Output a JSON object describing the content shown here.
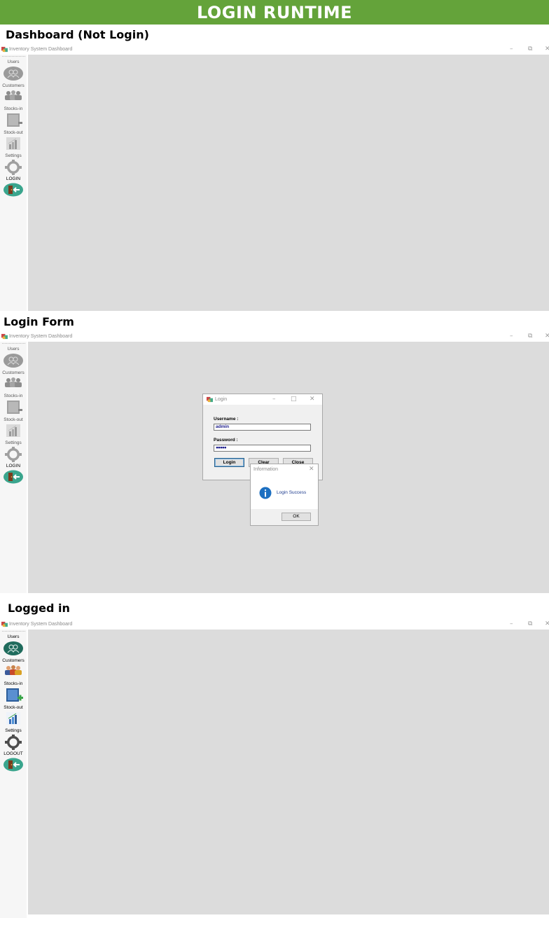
{
  "banner": {
    "title": "LOGIN RUNTIME"
  },
  "sections": [
    {
      "heading": "Dashboard (Not Login)",
      "window_title": "Inventory System Dashboard",
      "nav": [
        {
          "label": "Users",
          "icon": "users-icon",
          "active": false
        },
        {
          "label": "Customers",
          "icon": "customers-icon",
          "active": false
        },
        {
          "label": "Stocks-in",
          "icon": "stocks-in-icon",
          "active": false
        },
        {
          "label": "Stock-out",
          "icon": "stock-out-icon",
          "active": false
        },
        {
          "label": "Settings",
          "icon": "gear-icon",
          "active": false
        },
        {
          "label": "LOGIN",
          "icon": "login-door-icon",
          "active": true
        }
      ]
    },
    {
      "heading": "Login Form",
      "window_title": "Inventory System Dashboard",
      "nav": [
        {
          "label": "Users",
          "icon": "users-icon",
          "active": false
        },
        {
          "label": "Customers",
          "icon": "customers-icon",
          "active": false
        },
        {
          "label": "Stocks-in",
          "icon": "stocks-in-icon",
          "active": false
        },
        {
          "label": "Stock-out",
          "icon": "stock-out-icon",
          "active": false
        },
        {
          "label": "Settings",
          "icon": "gear-icon",
          "active": false
        },
        {
          "label": "LOGIN",
          "icon": "login-door-icon",
          "active": true
        }
      ],
      "login_dialog": {
        "title": "Login",
        "username_label": "Username :",
        "username_value": "admin",
        "password_label": "Password :",
        "password_value": "●●●●●",
        "login_button": "Login",
        "clear_button": "Clear",
        "close_button": "Close"
      },
      "message_box": {
        "title": "Information",
        "message": "Login Success",
        "ok_button": "OK",
        "icon": "info-icon"
      }
    },
    {
      "heading": "Logged in",
      "window_title": "Inventory System Dashboard",
      "nav": [
        {
          "label": "Users",
          "icon": "users-icon",
          "active": true
        },
        {
          "label": "Customers",
          "icon": "customers-icon",
          "active": true
        },
        {
          "label": "Stocks-in",
          "icon": "stocks-in-icon",
          "active": true
        },
        {
          "label": "Stock-out",
          "icon": "stock-out-icon",
          "active": true
        },
        {
          "label": "Settings",
          "icon": "gear-icon",
          "active": true
        },
        {
          "label": "LOGOUT",
          "icon": "logout-door-icon",
          "active": true
        }
      ]
    }
  ],
  "window_controls": {
    "minimize": "–",
    "restore": "⧉",
    "close": "✕"
  },
  "colors": {
    "banner": "#64a33a",
    "teal": "#3aa58d",
    "content_bg": "#dcdcdc",
    "info_blue": "#1c6fc1"
  }
}
